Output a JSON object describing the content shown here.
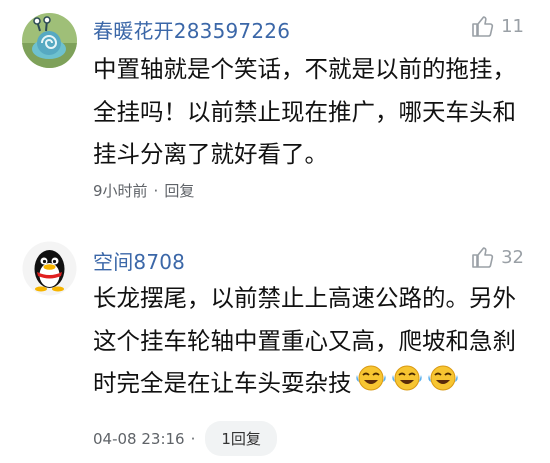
{
  "comments": [
    {
      "author": "春暖花开283597226",
      "likes": "11",
      "text": "中置轴就是个笑话，不就是以前的拖挂，全挂吗！以前禁止现在推广，哪天车头和挂斗分离了就好看了。",
      "time": "9小时前",
      "separator": "·",
      "reply_label": "回复"
    },
    {
      "author": "空间8708",
      "likes": "32",
      "text": "长龙摆尾，以前禁止上高速公路的。另外这个挂车轮轴中置重心又高，爬坡和急刹时完全是在让车头耍杂技",
      "emojis": [
        "laughing-crying-emoji",
        "laughing-crying-emoji",
        "laughing-crying-emoji"
      ],
      "time": "04-08 23:16",
      "separator": "·",
      "reply_label": "1回复"
    }
  ],
  "colors": {
    "author": "#3b67a8",
    "text": "#111111",
    "meta": "#5f6368",
    "like": "#9aa0a6",
    "pill_bg": "#f1f3f4"
  }
}
